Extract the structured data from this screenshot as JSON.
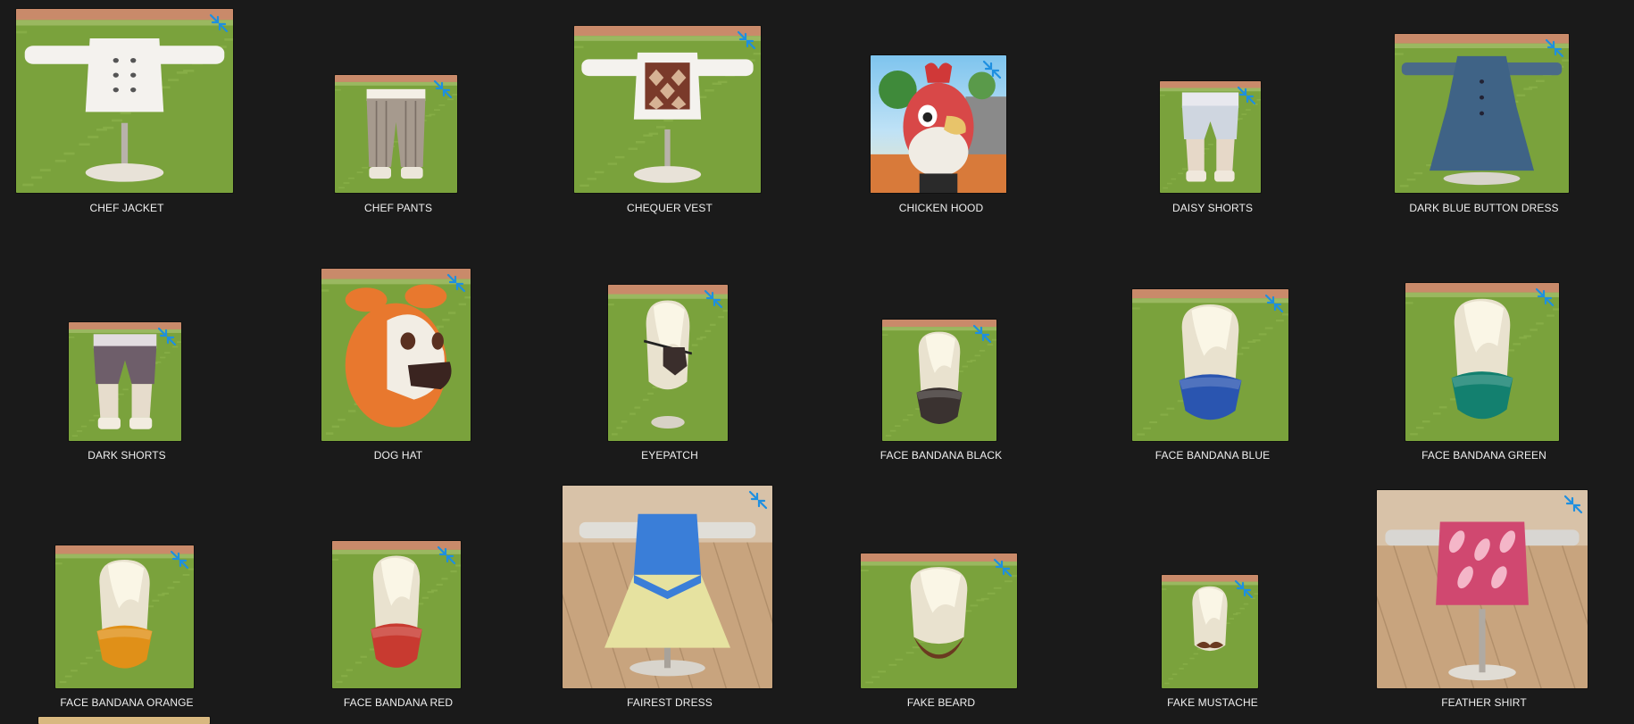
{
  "gallery": {
    "items": [
      {
        "label": "CHEF JACKET",
        "thumb": "chef-jacket",
        "bg": "grass"
      },
      {
        "label": "CHEF PANTS",
        "thumb": "chef-pants",
        "bg": "grass"
      },
      {
        "label": "CHEQUER VEST",
        "thumb": "chequer-vest",
        "bg": "grass"
      },
      {
        "label": "CHICKEN HOOD",
        "thumb": "chicken-hood",
        "bg": "sky"
      },
      {
        "label": "DAISY SHORTS",
        "thumb": "daisy-shorts",
        "bg": "grass"
      },
      {
        "label": "DARK BLUE BUTTON DRESS",
        "thumb": "dark-blue-button-dress",
        "bg": "grass"
      },
      {
        "label": "DARK SHORTS",
        "thumb": "dark-shorts",
        "bg": "grass"
      },
      {
        "label": "DOG HAT",
        "thumb": "dog-hat",
        "bg": "grass"
      },
      {
        "label": "EYEPATCH",
        "thumb": "eyepatch",
        "bg": "grass"
      },
      {
        "label": "FACE BANDANA BLACK",
        "thumb": "face-bandana-black",
        "bg": "grass"
      },
      {
        "label": "FACE BANDANA BLUE",
        "thumb": "face-bandana-blue",
        "bg": "grass"
      },
      {
        "label": "FACE BANDANA GREEN",
        "thumb": "face-bandana-green",
        "bg": "grass"
      },
      {
        "label": "FACE BANDANA ORANGE",
        "thumb": "face-bandana-orange",
        "bg": "grass"
      },
      {
        "label": "FACE BANDANA RED",
        "thumb": "face-bandana-red",
        "bg": "grass"
      },
      {
        "label": "FAIREST DRESS",
        "thumb": "fairest-dress",
        "bg": "wood"
      },
      {
        "label": "FAKE BEARD",
        "thumb": "fake-beard",
        "bg": "grass"
      },
      {
        "label": "FAKE MUSTACHE",
        "thumb": "fake-mustache",
        "bg": "grass"
      },
      {
        "label": "FEATHER SHIRT",
        "thumb": "feather-shirt",
        "bg": "wood"
      }
    ],
    "status_icon": "sync-arrows-icon"
  },
  "colors": {
    "background": "#1a1a1a",
    "caption_text": "#f0f0f0",
    "sync_icon": "#1e8fe0",
    "grass": "#7aa23c",
    "wood": "#c8a47e",
    "fabric_white": "#f4f2ee",
    "bandana_black": "#3a3230",
    "bandana_blue": "#2a55b0",
    "bandana_green": "#13806f",
    "bandana_orange": "#e09018",
    "bandana_red": "#c83a30"
  }
}
